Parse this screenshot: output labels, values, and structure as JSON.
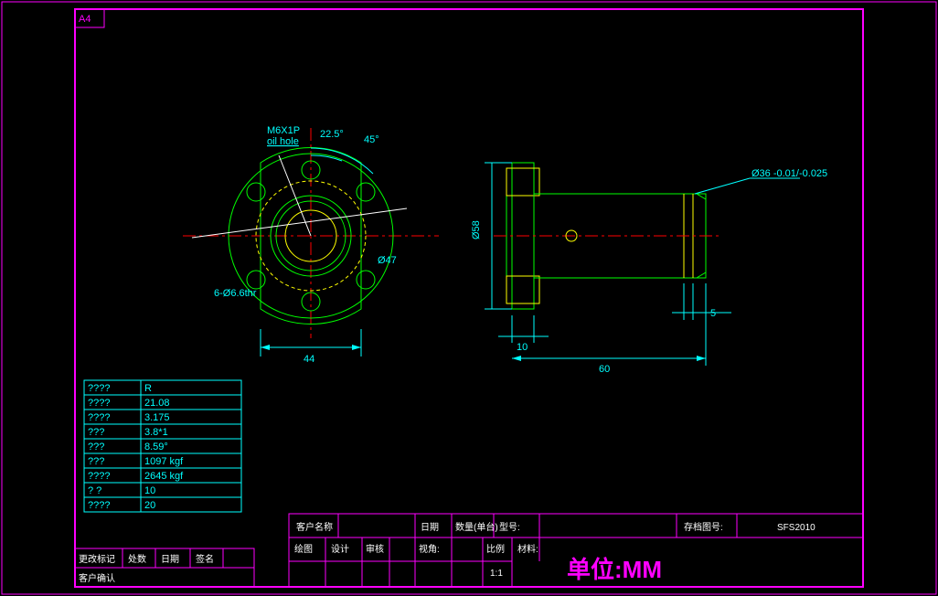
{
  "sheet_size": "A4",
  "labels": {
    "thread": "M6X1P",
    "oil": "oil hole",
    "ang1": "22.5°",
    "ang2": "45°",
    "bolt": "6-Ø6.6thr",
    "dia47": "Ø47",
    "dia58": "Ø58",
    "dia36": "Ø36 -0.01/-0.025",
    "dim44": "44",
    "dim10": "10",
    "dim60": "60",
    "dim5": "5"
  },
  "spec_table": [
    [
      "????",
      "R"
    ],
    [
      "????",
      "21.08"
    ],
    [
      "????",
      "3.175"
    ],
    [
      "???",
      "3.8*1"
    ],
    [
      "???",
      "8.59°"
    ],
    [
      "???",
      "1097 kgf"
    ],
    [
      "????",
      "2645 kgf"
    ],
    [
      "?  ?",
      "10"
    ],
    [
      "????",
      "20"
    ]
  ],
  "tb": {
    "customer_lbl": "客户名称",
    "date_lbl": "日期",
    "qty_lbl": "数量(单台)",
    "model_lbl": "型号:",
    "archive_lbl": "存档图号:",
    "archive_val": "SFS2010",
    "material_lbl": "材料:",
    "draw_lbl": "绘图",
    "design_lbl": "设计",
    "check_lbl": "审核",
    "view_lbl": "视角:",
    "scale_lbl": "比例",
    "scale_val": "1:1",
    "unit": "单位:MM",
    "change_mark": "更改标记",
    "count": "处数",
    "date2": "日期",
    "sign": "签名",
    "confirm": "客户确认"
  }
}
